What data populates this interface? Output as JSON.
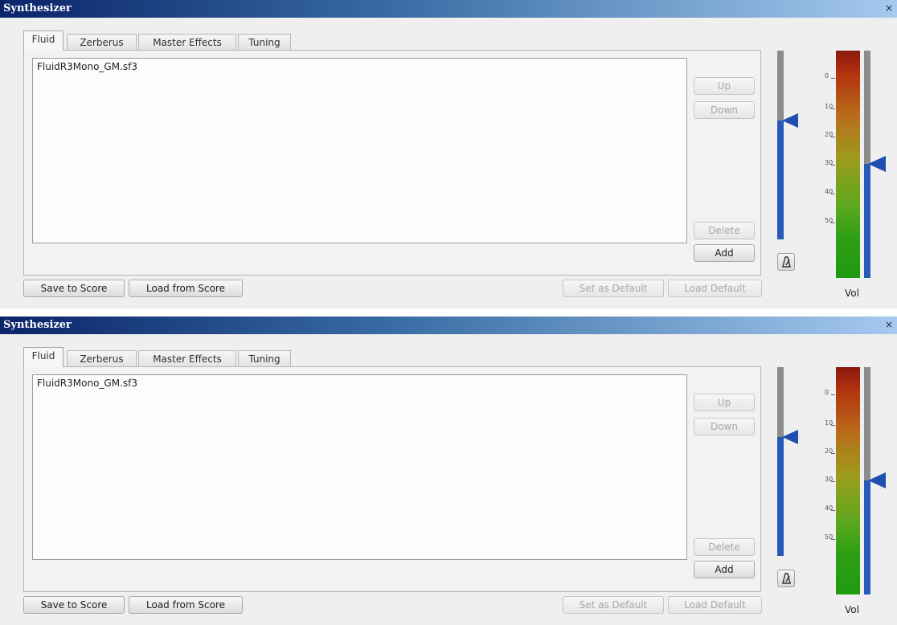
{
  "panels": [
    {
      "window_title": "Synthesizer",
      "tabs": [
        "Fluid",
        "Zerberus",
        "Master Effects",
        "Tuning"
      ],
      "active_tab": "Fluid",
      "soundfonts": [
        "FluidR3Mono_GM.sf3"
      ],
      "buttons": {
        "up": "Up",
        "down": "Down",
        "delete": "Delete",
        "add": "Add",
        "save_to_score": "Save to Score",
        "load_from_score": "Load from Score",
        "set_as_default": "Set as Default",
        "load_default": "Load Default"
      },
      "meter_scale": [
        "0",
        "10",
        "20",
        "30",
        "40",
        "50"
      ],
      "volume_label": "Vol",
      "close_glyph": "×",
      "tempo_slider_value": 0.63,
      "volume_slider_value": 0.5
    },
    {
      "window_title": "Synthesizer",
      "tabs": [
        "Fluid",
        "Zerberus",
        "Master Effects",
        "Tuning"
      ],
      "active_tab": "Fluid",
      "soundfonts": [
        "FluidR3Mono_GM.sf3"
      ],
      "buttons": {
        "up": "Up",
        "down": "Down",
        "delete": "Delete",
        "add": "Add",
        "save_to_score": "Save to Score",
        "load_from_score": "Load from Score",
        "set_as_default": "Set as Default",
        "load_default": "Load Default"
      },
      "meter_scale": [
        "0",
        "10",
        "20",
        "30",
        "40",
        "50"
      ],
      "volume_label": "Vol",
      "close_glyph": "×",
      "tempo_slider_value": 0.63,
      "volume_slider_value": 0.5
    }
  ],
  "colors": {
    "titlebar_start": "#0a246a",
    "titlebar_end": "#a6caf0",
    "slider_blue": "#2858b8",
    "meter_top": "#8a1a0e",
    "meter_bottom": "#1f9a0f"
  }
}
